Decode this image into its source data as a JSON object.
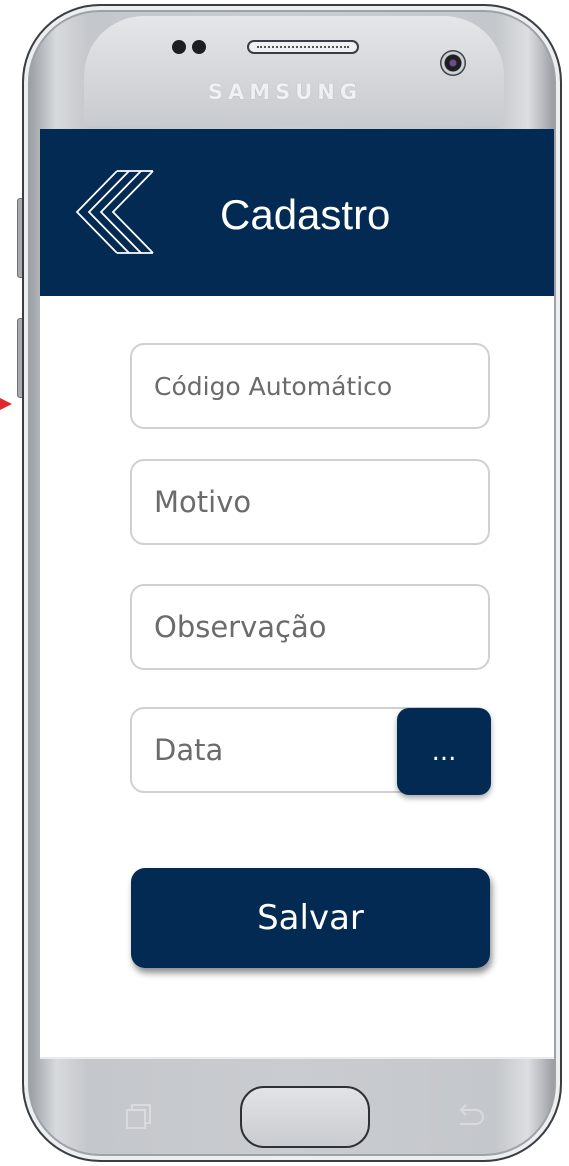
{
  "device": {
    "brand": "SAMSUNG"
  },
  "header": {
    "title": "Cadastro",
    "back_icon": "double-chevron-left-icon",
    "background_color": "#032a52"
  },
  "form": {
    "code_placeholder": "Código Automático",
    "reason_placeholder": "Motivo",
    "notes_placeholder": "Observação",
    "date_placeholder": "Data",
    "date_picker_label": "...",
    "save_label": "Salvar"
  },
  "colors": {
    "primary": "#032a52",
    "field_border": "#d0d0d0",
    "placeholder_text": "#6b6b6b",
    "marker": "#e3262b"
  }
}
